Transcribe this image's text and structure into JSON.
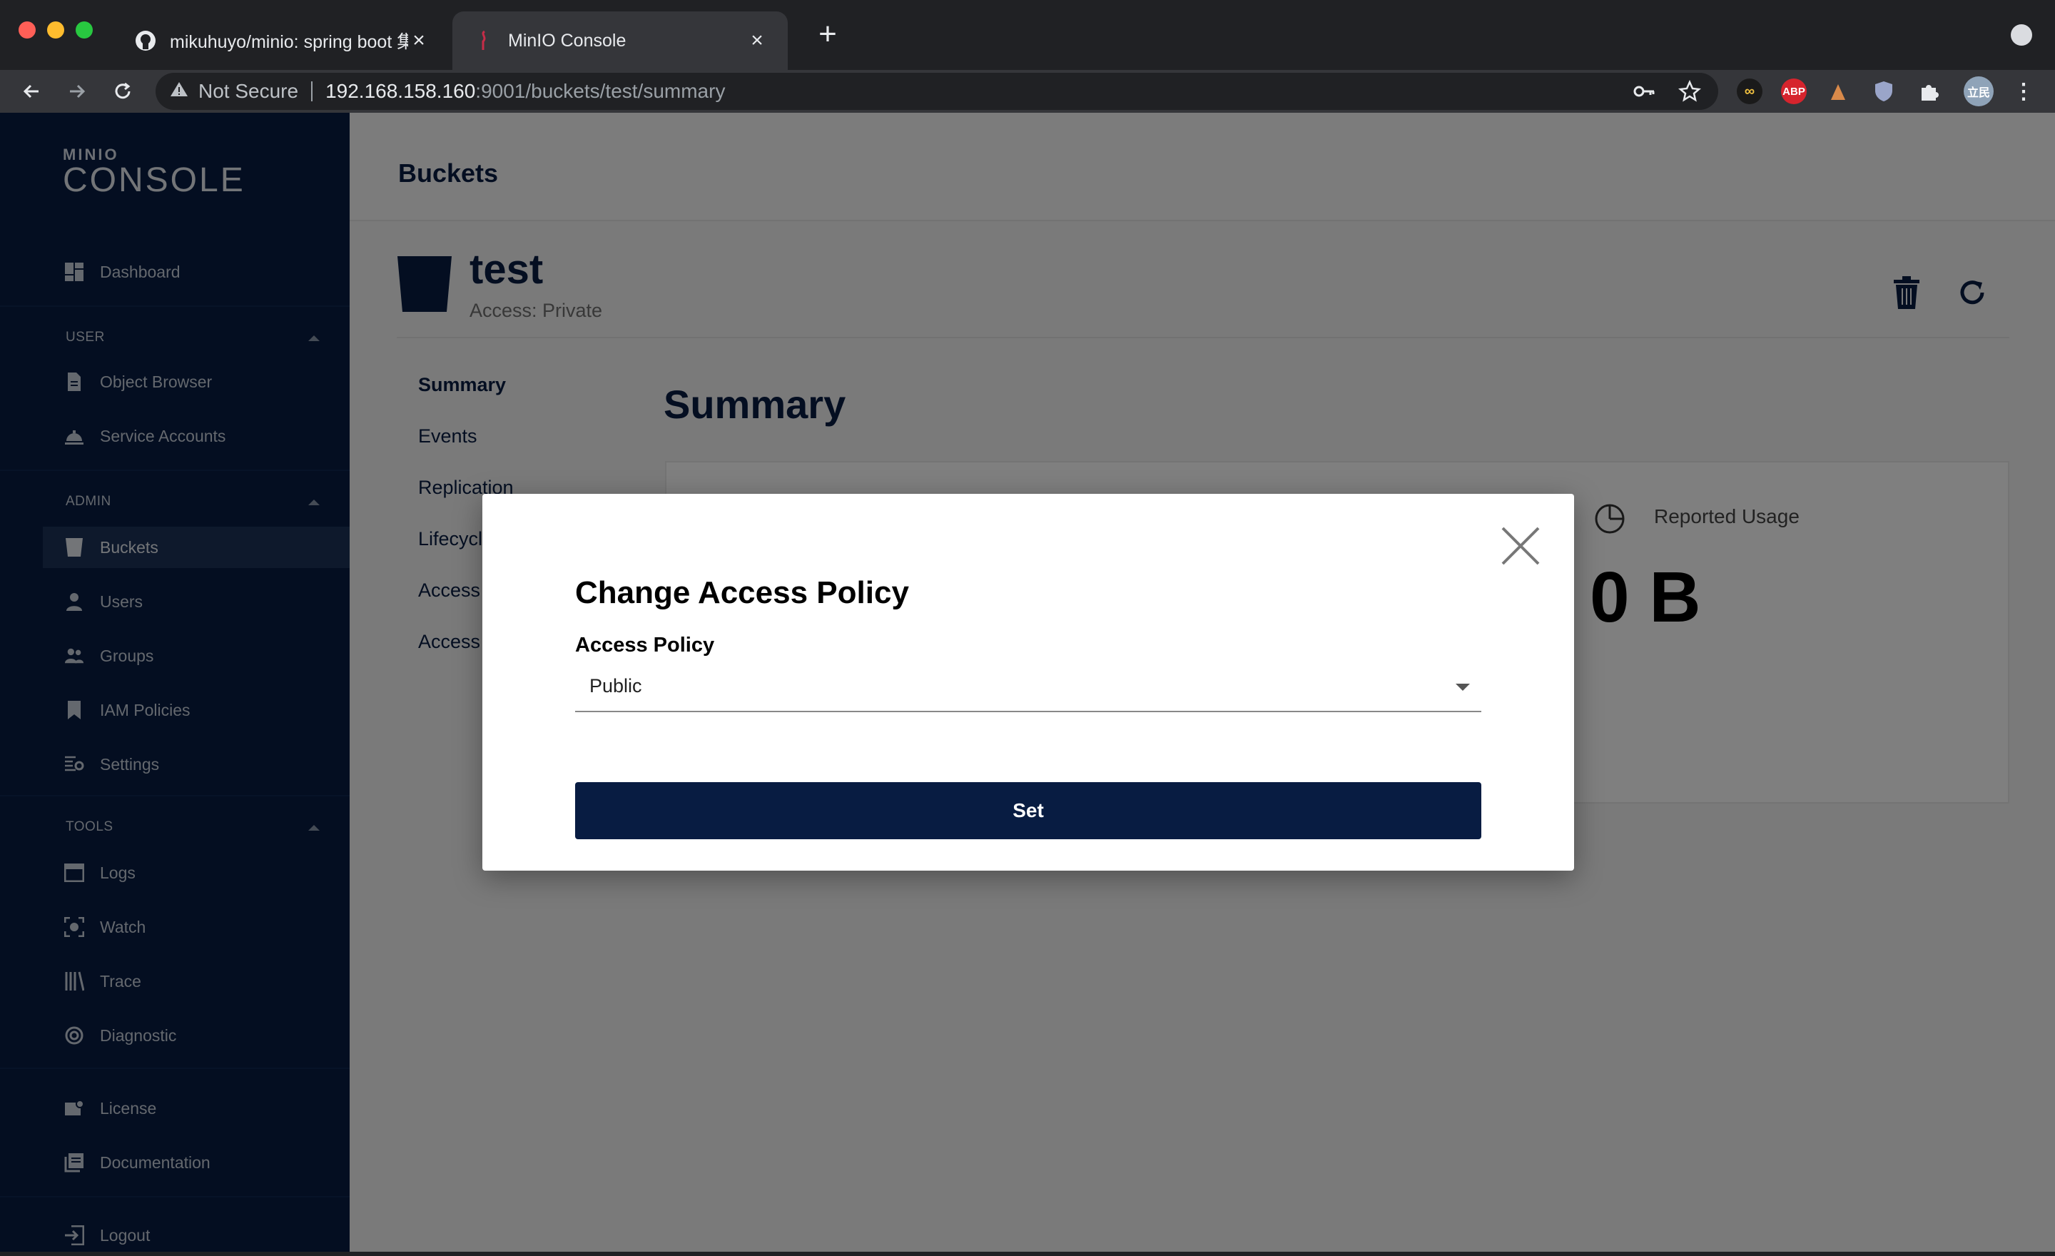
{
  "browser": {
    "tabs": [
      {
        "title": "mikuhuyo/minio: spring boot 集",
        "favicon": "github-icon"
      },
      {
        "title": "MinIO Console",
        "favicon": "minio-flamingo-icon"
      }
    ],
    "address": {
      "security": "Not Secure",
      "host": "192.168.158.160",
      "path": ":9001/buckets/test/summary"
    },
    "extensions": {
      "abp": "ABP",
      "profile": "立民"
    }
  },
  "sidebar": {
    "logo": {
      "top": "MINIO",
      "bottom": "CONSOLE"
    },
    "dashboard": "Dashboard",
    "sections": {
      "user": "USER",
      "admin": "ADMIN",
      "tools": "TOOLS"
    },
    "user_items": [
      "Object Browser",
      "Service Accounts"
    ],
    "admin_items": [
      "Buckets",
      "Users",
      "Groups",
      "IAM Policies",
      "Settings"
    ],
    "tools_items": [
      "Logs",
      "Watch",
      "Trace",
      "Diagnostic"
    ],
    "bottom_items": [
      "License",
      "Documentation"
    ],
    "logout": "Logout"
  },
  "main": {
    "page_title": "Buckets",
    "bucket": {
      "name": "test",
      "access": "Access: Private"
    },
    "subnav": [
      "Summary",
      "Events",
      "Replication",
      "Lifecycl",
      "Access",
      "Access"
    ],
    "summary_heading": "Summary",
    "usage": {
      "label": "Reported Usage",
      "value": "0 B"
    }
  },
  "modal": {
    "title": "Change Access Policy",
    "field_label": "Access Policy",
    "selected_value": "Public",
    "submit_label": "Set"
  },
  "colors": {
    "sidebar_bg": "#081c42",
    "primary": "#081c42",
    "browser_bg": "#202124"
  }
}
